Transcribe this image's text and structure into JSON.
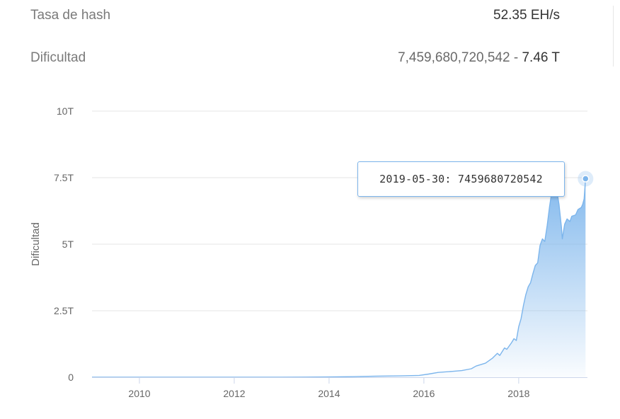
{
  "stats": {
    "hashrate_label": "Tasa de hash",
    "hashrate_value": "52.35 EH/s",
    "difficulty_label": "Dificultad",
    "difficulty_value": "7,459,680,720,542",
    "difficulty_sep": " - ",
    "difficulty_short": "7.46 T"
  },
  "tooltip": {
    "text": "2019-05-30: 7459680720542"
  },
  "colors": {
    "series": "#7cb5ec",
    "grid": "#e6e6e6",
    "axis": "#ccd6eb",
    "label": "#666666"
  },
  "chart_data": {
    "type": "area",
    "title": "",
    "xlabel": "",
    "ylabel": "Dificultad",
    "xlim": [
      2009.0,
      2019.45
    ],
    "ylim": [
      0,
      10
    ],
    "y_unit": "T",
    "y_ticks": [
      0,
      2.5,
      5,
      7.5,
      10
    ],
    "y_tick_labels": [
      "0",
      "2.5T",
      "5T",
      "7.5T",
      "10T"
    ],
    "x_ticks": [
      2010,
      2012,
      2014,
      2016,
      2018
    ],
    "x_tick_labels": [
      "2010",
      "2012",
      "2014",
      "2016",
      "2018"
    ],
    "grid": true,
    "legend": "none",
    "highlighted_point": {
      "x": "2019-05-30",
      "y": 7.46
    },
    "series": [
      {
        "values": [
          [
            2009.0,
            0.0
          ],
          [
            2010.0,
            0.0
          ],
          [
            2011.0,
            0.0
          ],
          [
            2012.0,
            0.0
          ],
          [
            2013.0,
            0.0
          ],
          [
            2013.5,
            0.005
          ],
          [
            2014.0,
            0.01
          ],
          [
            2014.5,
            0.02
          ],
          [
            2015.0,
            0.04
          ],
          [
            2015.5,
            0.05
          ],
          [
            2015.9,
            0.07
          ],
          [
            2016.1,
            0.12
          ],
          [
            2016.3,
            0.18
          ],
          [
            2016.6,
            0.22
          ],
          [
            2016.8,
            0.25
          ],
          [
            2017.0,
            0.32
          ],
          [
            2017.1,
            0.42
          ],
          [
            2017.3,
            0.53
          ],
          [
            2017.45,
            0.72
          ],
          [
            2017.55,
            0.9
          ],
          [
            2017.6,
            0.82
          ],
          [
            2017.7,
            1.1
          ],
          [
            2017.75,
            1.05
          ],
          [
            2017.85,
            1.3
          ],
          [
            2017.9,
            1.45
          ],
          [
            2017.95,
            1.38
          ],
          [
            2018.0,
            1.9
          ],
          [
            2018.05,
            2.2
          ],
          [
            2018.1,
            2.7
          ],
          [
            2018.15,
            3.1
          ],
          [
            2018.2,
            3.4
          ],
          [
            2018.25,
            3.55
          ],
          [
            2018.3,
            3.9
          ],
          [
            2018.35,
            4.2
          ],
          [
            2018.4,
            4.3
          ],
          [
            2018.45,
            4.95
          ],
          [
            2018.5,
            5.2
          ],
          [
            2018.55,
            5.1
          ],
          [
            2018.6,
            5.7
          ],
          [
            2018.65,
            6.4
          ],
          [
            2018.7,
            7.0
          ],
          [
            2018.75,
            7.15
          ],
          [
            2018.8,
            7.05
          ],
          [
            2018.85,
            6.5
          ],
          [
            2018.9,
            5.65
          ],
          [
            2018.92,
            5.2
          ],
          [
            2018.97,
            5.75
          ],
          [
            2019.02,
            5.95
          ],
          [
            2019.08,
            5.85
          ],
          [
            2019.12,
            6.05
          ],
          [
            2019.2,
            6.1
          ],
          [
            2019.25,
            6.3
          ],
          [
            2019.32,
            6.38
          ],
          [
            2019.35,
            6.5
          ],
          [
            2019.38,
            6.7
          ],
          [
            2019.41,
            7.46
          ]
        ]
      }
    ]
  }
}
